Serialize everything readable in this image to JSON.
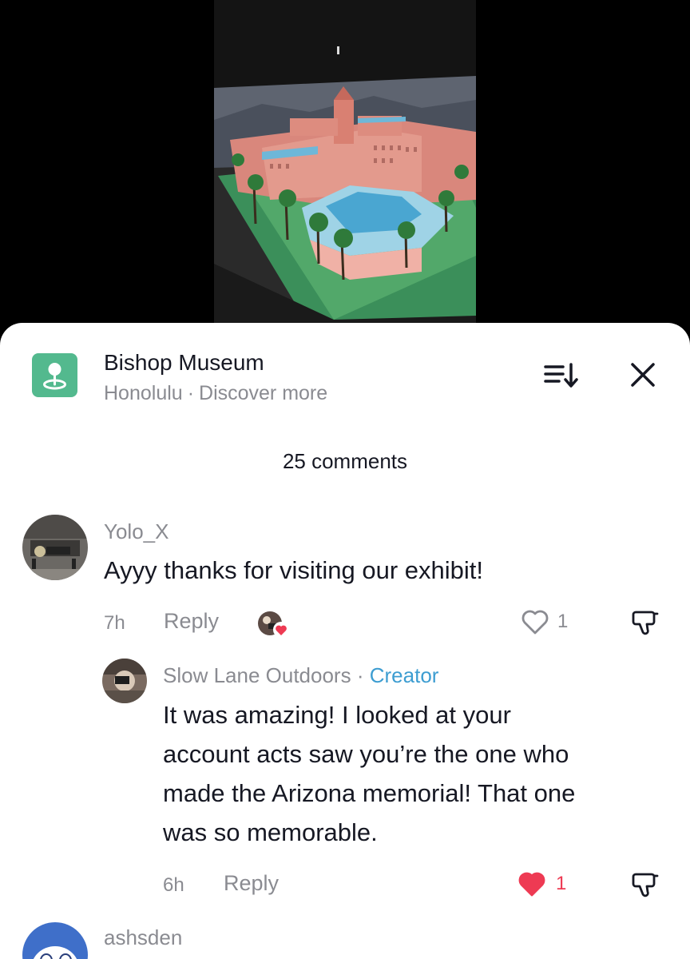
{
  "place": {
    "name": "Bishop Museum",
    "city": "Honolulu",
    "separator": "·",
    "cta": "Discover more"
  },
  "icons": {
    "place": "location-pin-icon",
    "sort": "sort-icon",
    "close": "close-icon",
    "like": "heart-icon",
    "dislike": "thumbs-down-icon"
  },
  "colors": {
    "place_icon_bg": "#53b98e",
    "creator": "#3d9dd1",
    "liked_heart": "#ee3a53",
    "muted": "#8a8b91",
    "text": "#161823"
  },
  "comments_header": "25 comments",
  "comments": [
    {
      "username": "Yolo_X",
      "text": "Ayyy thanks for visiting our exhibit!",
      "time": "7h",
      "reply_label": "Reply",
      "likes": "1",
      "liked": false,
      "creator_liked": true,
      "replies": [
        {
          "username": "Slow Lane Outdoors",
          "separator": "·",
          "badge": "Creator",
          "text_lines": [
            "It was amazing! I looked at your",
            "account acts saw you’re the one who",
            "made the Arizona memorial! That one",
            "was so memorable."
          ],
          "time": "6h",
          "reply_label": "Reply",
          "likes": "1",
          "liked": true
        }
      ]
    },
    {
      "username": "ashsden"
    }
  ]
}
